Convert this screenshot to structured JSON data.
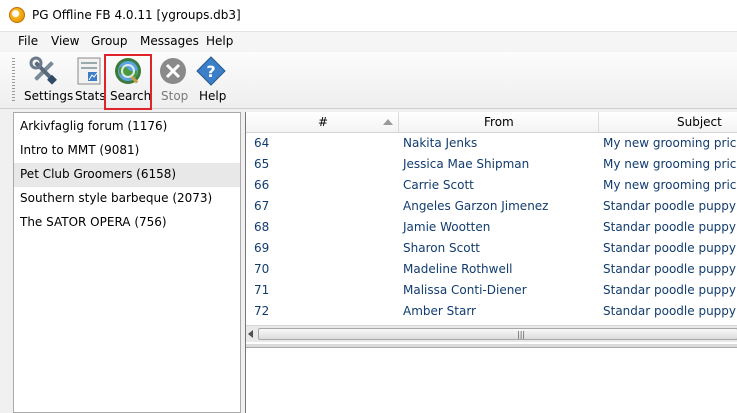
{
  "window": {
    "title": "PG Offline FB 4.0.11  [ygroups.db3]"
  },
  "menu": {
    "items": [
      "File",
      "View",
      "Group",
      "Messages",
      "Help"
    ]
  },
  "toolbar": {
    "buttons": [
      {
        "label": "Settings",
        "icon": "settings-icon"
      },
      {
        "label": "Stats",
        "icon": "stats-icon"
      },
      {
        "label": "Search",
        "icon": "search-icon",
        "highlighted": true
      },
      {
        "label": "Stop",
        "icon": "stop-icon",
        "disabled": true
      },
      {
        "label": "Help",
        "icon": "help-icon"
      }
    ]
  },
  "groups": [
    "Arkivfaglig forum (1176)",
    "Intro to MMT (9081)",
    "Pet Club Groomers (6158)",
    "Southern style barbeque (2073)",
    "The SATOR OPERA (756)"
  ],
  "grid": {
    "headers": {
      "num": "#",
      "from": "From",
      "subject": "Subject"
    },
    "rows": [
      {
        "num": "64",
        "from": "Nakita Jenks",
        "subject": "My new grooming prices c"
      },
      {
        "num": "65",
        "from": "Jessica Mae Shipman",
        "subject": "My new grooming prices c"
      },
      {
        "num": "66",
        "from": "Carrie Scott",
        "subject": "My new grooming prices c"
      },
      {
        "num": "67",
        "from": "Angeles Garzon Jimenez",
        "subject": "Standar poodle puppy's fi"
      },
      {
        "num": "68",
        "from": "Jamie Wootten",
        "subject": "Standar poodle puppy's fi"
      },
      {
        "num": "69",
        "from": "Sharon Scott",
        "subject": "Standar poodle puppy's fi"
      },
      {
        "num": "70",
        "from": "Madeline Rothwell",
        "subject": "Standar poodle puppy's fi"
      },
      {
        "num": "71",
        "from": "Malissa Conti-Diener",
        "subject": "Standar poodle puppy's fi"
      },
      {
        "num": "72",
        "from": "Amber Starr",
        "subject": "Standar poodle puppy's fi"
      }
    ]
  },
  "colors": {
    "link_text": "#123c6f",
    "highlight_border": "#e0232b",
    "selected_row": "#e8e8e8"
  }
}
